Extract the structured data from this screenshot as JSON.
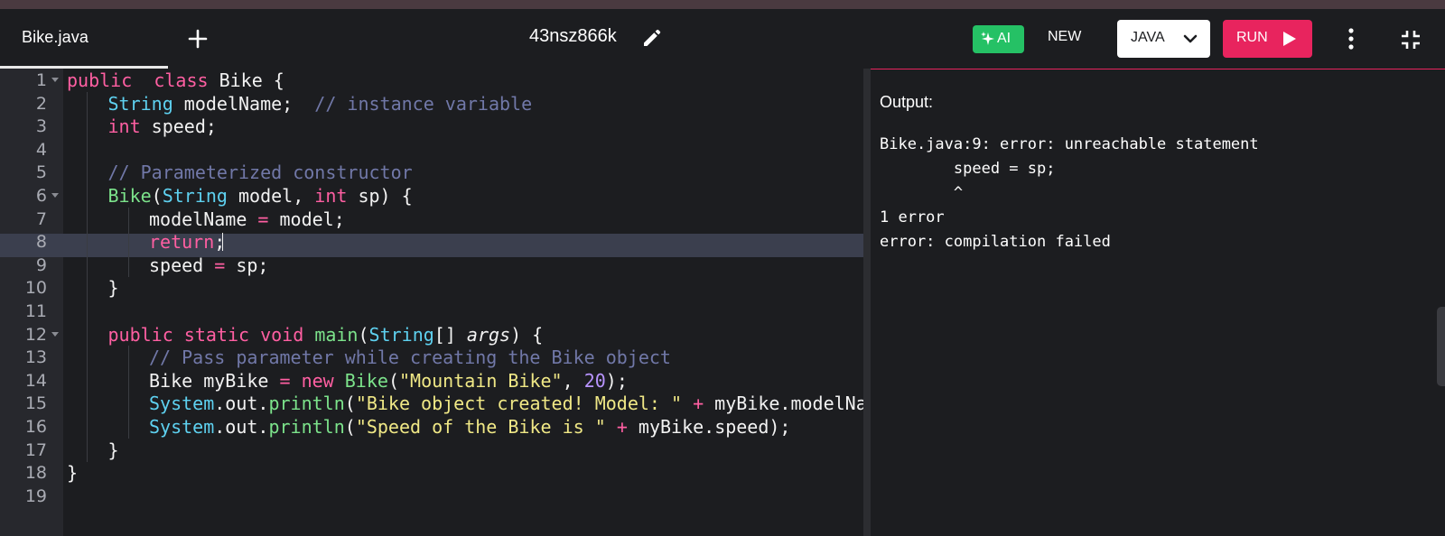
{
  "tabs": [
    {
      "label": "Bike.java",
      "active": true
    }
  ],
  "header": {
    "filename": "43nsz866k"
  },
  "toolbar": {
    "ai_label": "AI",
    "new_label": "NEW",
    "language": "JAVA",
    "run_label": "RUN"
  },
  "colors": {
    "ai": "#25c165",
    "run": "#e8245e",
    "active_line": "#3b3f4e"
  },
  "editor": {
    "active_line": 8,
    "lines": [
      {
        "n": "1",
        "fold": true,
        "indent": 0,
        "tokens": [
          [
            "kw",
            "public"
          ],
          [
            "",
            "  "
          ],
          [
            "kw",
            "class"
          ],
          [
            "",
            " Bike {"
          ]
        ]
      },
      {
        "n": "2",
        "fold": false,
        "indent": 1,
        "tokens": [
          [
            "ty",
            "String"
          ],
          [
            "",
            " modelName;  "
          ],
          [
            "cm",
            "// instance variable"
          ]
        ]
      },
      {
        "n": "3",
        "fold": false,
        "indent": 1,
        "tokens": [
          [
            "kw",
            "int"
          ],
          [
            "",
            " speed;"
          ]
        ]
      },
      {
        "n": "4",
        "fold": false,
        "indent": 1,
        "tokens": []
      },
      {
        "n": "5",
        "fold": false,
        "indent": 1,
        "tokens": [
          [
            "cm",
            "// Parameterized constructor"
          ]
        ]
      },
      {
        "n": "6",
        "fold": true,
        "indent": 1,
        "tokens": [
          [
            "fn",
            "Bike"
          ],
          [
            "",
            "("
          ],
          [
            "ty",
            "String"
          ],
          [
            "",
            " model, "
          ],
          [
            "kw",
            "int"
          ],
          [
            "",
            " sp) {"
          ]
        ]
      },
      {
        "n": "7",
        "fold": false,
        "indent": 2,
        "tokens": [
          [
            "",
            "modelName "
          ],
          [
            "op",
            "="
          ],
          [
            "",
            " model;"
          ]
        ]
      },
      {
        "n": "8",
        "fold": false,
        "indent": 2,
        "tokens": [
          [
            "kw",
            "return"
          ],
          [
            "",
            ";"
          ]
        ]
      },
      {
        "n": "9",
        "fold": false,
        "indent": 2,
        "tokens": [
          [
            "",
            "speed "
          ],
          [
            "op",
            "="
          ],
          [
            "",
            " sp;"
          ]
        ]
      },
      {
        "n": "10",
        "fold": false,
        "indent": 1,
        "tokens": [
          [
            "",
            "}"
          ]
        ]
      },
      {
        "n": "11",
        "fold": false,
        "indent": 1,
        "tokens": []
      },
      {
        "n": "12",
        "fold": true,
        "indent": 1,
        "tokens": [
          [
            "kw",
            "public"
          ],
          [
            "",
            " "
          ],
          [
            "kw",
            "static"
          ],
          [
            "",
            " "
          ],
          [
            "kw",
            "void"
          ],
          [
            "",
            " "
          ],
          [
            "fn",
            "main"
          ],
          [
            "",
            "("
          ],
          [
            "ty",
            "String"
          ],
          [
            "",
            "[] "
          ],
          [
            "it",
            "args"
          ],
          [
            "",
            ") {"
          ]
        ]
      },
      {
        "n": "13",
        "fold": false,
        "indent": 2,
        "tokens": [
          [
            "cm",
            "// Pass parameter while creating the Bike object"
          ]
        ]
      },
      {
        "n": "14",
        "fold": false,
        "indent": 2,
        "tokens": [
          [
            "",
            "Bike myBike "
          ],
          [
            "op",
            "="
          ],
          [
            "",
            " "
          ],
          [
            "kw",
            "new"
          ],
          [
            "",
            " "
          ],
          [
            "fn",
            "Bike"
          ],
          [
            "",
            "("
          ],
          [
            "st",
            "\"Mountain Bike\""
          ],
          [
            "",
            ", "
          ],
          [
            "nu",
            "20"
          ],
          [
            "",
            ");"
          ]
        ]
      },
      {
        "n": "15",
        "fold": false,
        "indent": 2,
        "tokens": [
          [
            "ty",
            "System"
          ],
          [
            "",
            ".out."
          ],
          [
            "fn",
            "println"
          ],
          [
            "",
            "("
          ],
          [
            "st",
            "\"Bike object created! Model: \""
          ],
          [
            "",
            " "
          ],
          [
            "op",
            "+"
          ],
          [
            "",
            " myBike.modelName"
          ]
        ]
      },
      {
        "n": "16",
        "fold": false,
        "indent": 2,
        "tokens": [
          [
            "ty",
            "System"
          ],
          [
            "",
            ".out."
          ],
          [
            "fn",
            "println"
          ],
          [
            "",
            "("
          ],
          [
            "st",
            "\"Speed of the Bike is \""
          ],
          [
            "",
            " "
          ],
          [
            "op",
            "+"
          ],
          [
            "",
            " myBike.speed);"
          ]
        ]
      },
      {
        "n": "17",
        "fold": false,
        "indent": 1,
        "tokens": [
          [
            "",
            "}"
          ]
        ]
      },
      {
        "n": "18",
        "fold": false,
        "indent": 0,
        "tokens": [
          [
            "",
            "}"
          ]
        ]
      },
      {
        "n": "19",
        "fold": false,
        "indent": 0,
        "tokens": []
      }
    ]
  },
  "output": {
    "label": "Output:",
    "lines": [
      "Bike.java:9: error: unreachable statement",
      "        speed = sp;",
      "        ^",
      "1 error",
      "error: compilation failed"
    ]
  }
}
